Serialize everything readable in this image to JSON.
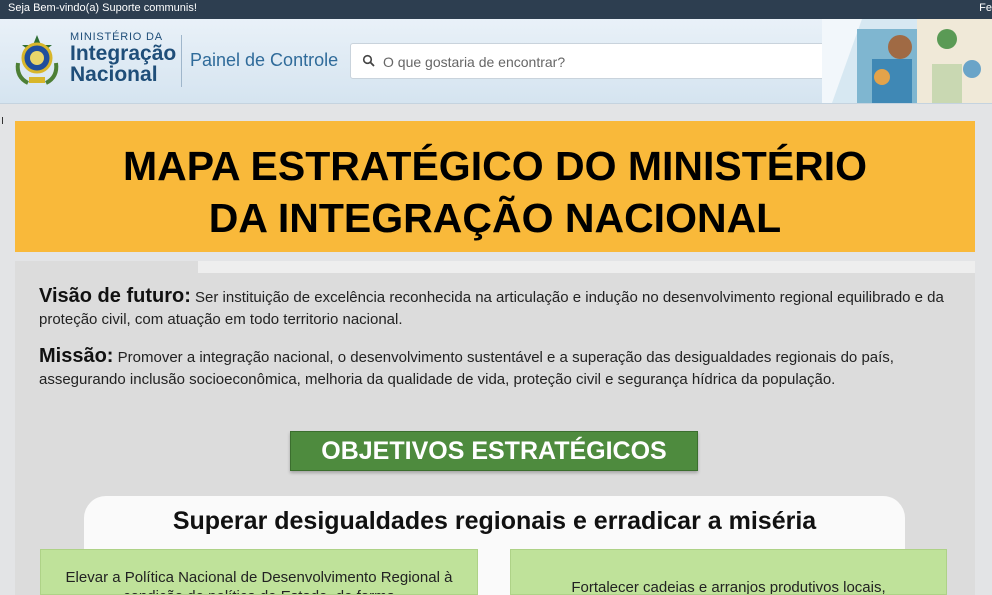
{
  "topbar": {
    "welcome": "Seja Bem-vindo(a) Suporte communis!",
    "right_text": "Fe"
  },
  "header": {
    "ministry_small": "MINISTÉRIO DA",
    "ministry_line1": "Integração",
    "ministry_line2": "Nacional",
    "panel_link": "Painel de Controle",
    "search_placeholder": "O que gostaria de encontrar?"
  },
  "title": {
    "line1": "MAPA ESTRATÉGICO DO MINISTÉRIO",
    "line2": "DA INTEGRAÇÃO NACIONAL"
  },
  "vision": {
    "label": "Visão de futuro:",
    "text": " Ser instituição de excelência reconhecida na articulação e indução no desenvolvimento regional equilibrado e da proteção civil, com atuação em todo territorio nacional."
  },
  "mission": {
    "label": "Missão:",
    "text": " Promover a integração nacional, o desenvolvimento sustentável e a superação das desigualdades regionais do país, assegurando inclusão socioeconômica, melhoria da qualidade de vida, proteção civil e segurança hídrica da população."
  },
  "objectives_button": "OBJETIVOS ESTRATÉGICOS",
  "section": {
    "title": "Superar desigualdades regionais e erradicar a miséria",
    "cards": [
      {
        "text": "Elevar a Política Nacional de Desenvolvimento Regional à condição de política de Estado, de forma"
      },
      {
        "text": "Fortalecer cadeias e arranjos produtivos locais,"
      }
    ]
  },
  "colors": {
    "topbar": "#2d3e50",
    "title_bg": "#f9b93a",
    "objectives_bg": "#4e8b3e",
    "card_green": "#bfe29a"
  }
}
